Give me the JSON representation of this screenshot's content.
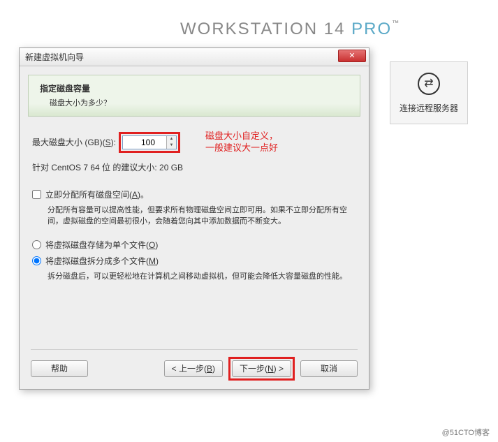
{
  "brand": {
    "name": "WORKSTATION 14 ",
    "pro": "PRO",
    "tm": "™"
  },
  "remote": {
    "label": "连接远程服务器"
  },
  "dialog": {
    "title": "新建虚拟机向导",
    "close": "✕",
    "header": {
      "title": "指定磁盘容量",
      "subtitle": "磁盘大小为多少？"
    },
    "size": {
      "label_prefix": "最大磁盘大小 (GB)(",
      "label_key": "S",
      "label_suffix": "):",
      "value": "100",
      "recommend": "针对 CentOS 7 64 位 的建议大小: 20 GB"
    },
    "annotation": {
      "line1": "磁盘大小自定义，",
      "line2": "一般建议大一点好"
    },
    "allocate": {
      "label_prefix": "立即分配所有磁盘空间(",
      "label_key": "A",
      "label_suffix": ")。",
      "desc": "分配所有容量可以提高性能，但要求所有物理磁盘空间立即可用。如果不立即分配所有空间，虚拟磁盘的空间最初很小，会随着您向其中添加数据而不断变大。"
    },
    "radios": {
      "single": {
        "label_prefix": "将虚拟磁盘存储为单个文件(",
        "label_key": "O",
        "label_suffix": ")"
      },
      "split": {
        "label_prefix": "将虚拟磁盘拆分成多个文件(",
        "label_key": "M",
        "label_suffix": ")",
        "desc": "拆分磁盘后，可以更轻松地在计算机之间移动虚拟机，但可能会降低大容量磁盘的性能。"
      }
    },
    "buttons": {
      "help": "帮助",
      "back_prefix": "< 上一步(",
      "back_key": "B",
      "back_suffix": ")",
      "next_prefix": "下一步(",
      "next_key": "N",
      "next_suffix": ") >",
      "cancel": "取消"
    }
  },
  "watermark": "@51CTO博客"
}
